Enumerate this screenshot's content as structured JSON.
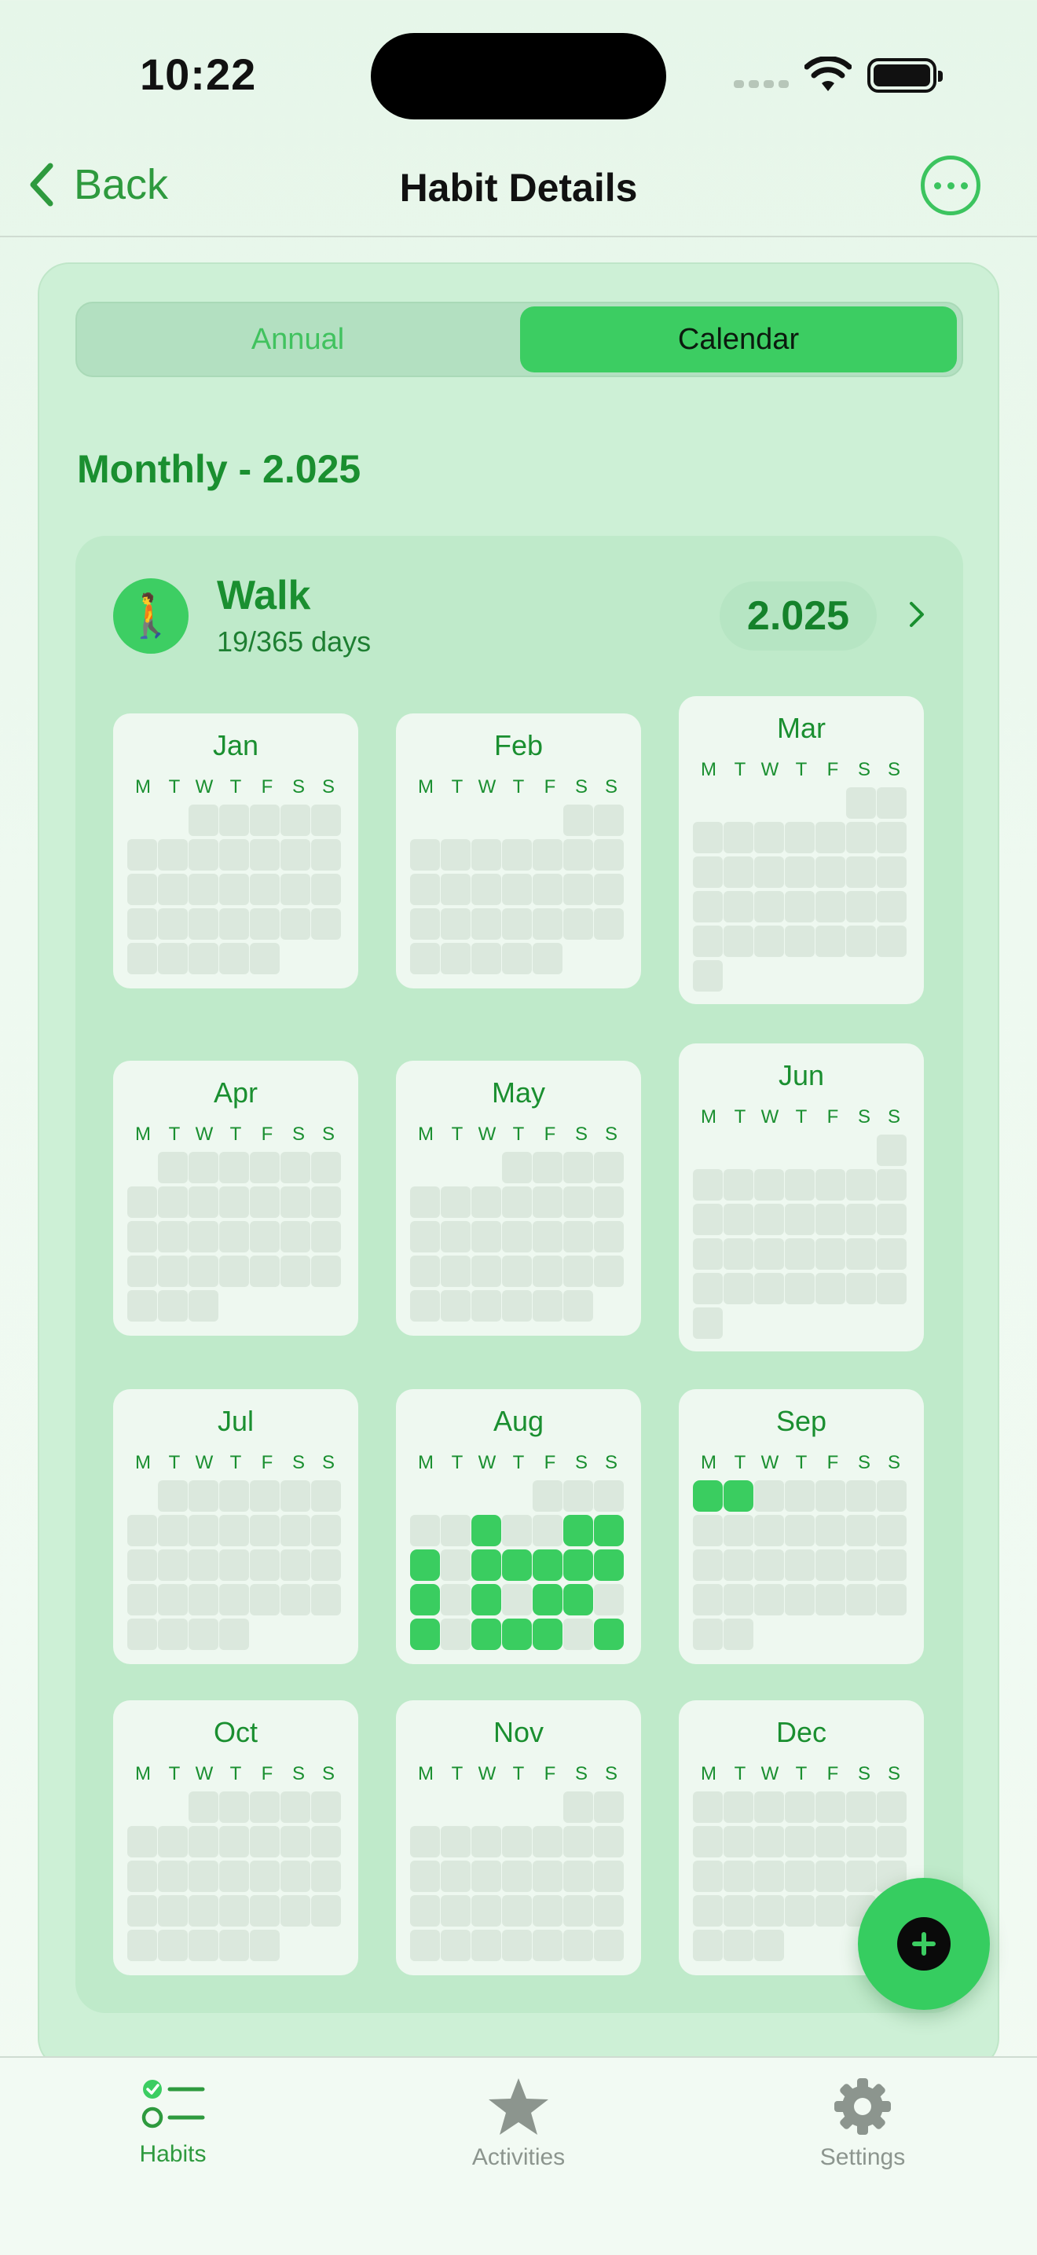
{
  "status_bar": {
    "time": "10:22"
  },
  "nav": {
    "back_label": "Back",
    "title": "Habit Details"
  },
  "segmented": {
    "options": [
      "Annual",
      "Calendar"
    ],
    "selected": "Calendar"
  },
  "section_title": "Monthly - 2.025",
  "habit": {
    "emoji": "🚶",
    "name": "Walk",
    "progress": "19/365 days",
    "year": "2.025"
  },
  "weekdays": [
    "M",
    "T",
    "W",
    "T",
    "F",
    "S",
    "S"
  ],
  "months": [
    {
      "name": "Jan",
      "start": 2,
      "days": 31,
      "done": []
    },
    {
      "name": "Feb",
      "start": 5,
      "days": 28,
      "done": []
    },
    {
      "name": "Mar",
      "start": 5,
      "days": 31,
      "done": []
    },
    {
      "name": "Apr",
      "start": 1,
      "days": 30,
      "done": []
    },
    {
      "name": "May",
      "start": 3,
      "days": 31,
      "done": []
    },
    {
      "name": "Jun",
      "start": 6,
      "days": 30,
      "done": []
    },
    {
      "name": "Jul",
      "start": 1,
      "days": 31,
      "done": []
    },
    {
      "name": "Aug",
      "start": 4,
      "days": 31,
      "done": [
        6,
        9,
        10,
        11,
        13,
        14,
        15,
        16,
        17,
        18,
        20,
        22,
        23,
        25,
        27,
        28,
        29,
        31
      ]
    },
    {
      "name": "Sep",
      "start": 0,
      "days": 30,
      "done": [
        1,
        2
      ]
    },
    {
      "name": "Oct",
      "start": 2,
      "days": 31,
      "done": []
    },
    {
      "name": "Nov",
      "start": 5,
      "days": 30,
      "done": []
    },
    {
      "name": "Dec",
      "start": 0,
      "days": 31,
      "done": []
    }
  ],
  "tabs": [
    {
      "label": "Habits",
      "icon": "habits-list-icon",
      "active": true
    },
    {
      "label": "Activities",
      "icon": "star-icon",
      "active": false
    },
    {
      "label": "Settings",
      "icon": "gear-icon",
      "active": false
    }
  ],
  "colors": {
    "accent": "#3ccd62",
    "accent_text": "#1a8f30",
    "empty_cell": "#dbe8dd",
    "inactive_tab": "#8c958e"
  }
}
